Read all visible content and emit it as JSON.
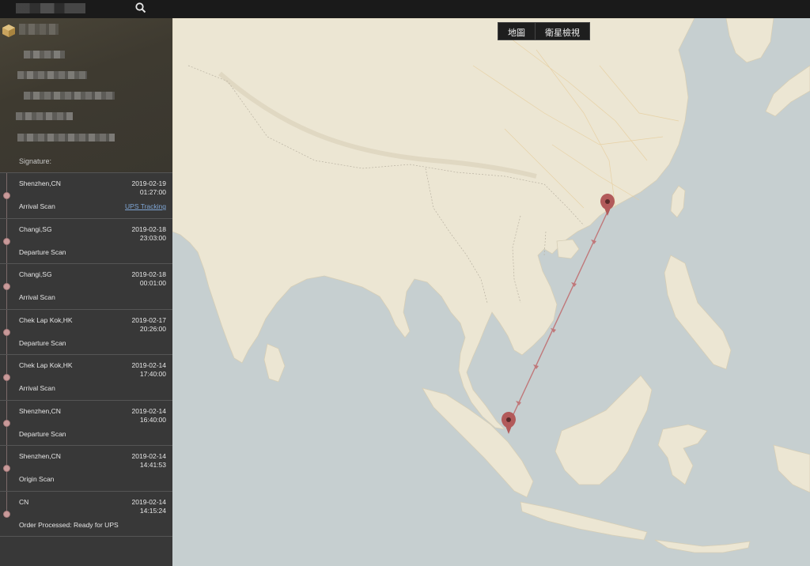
{
  "search": {
    "icon": "search-icon"
  },
  "sidebar": {
    "signature_label": "Signature:",
    "events": [
      {
        "location": "Shenzhen,CN",
        "date": "2019-02-19",
        "time": "01:27:00",
        "status": "Arrival Scan",
        "link": "UPS Tracking"
      },
      {
        "location": "Changi,SG",
        "date": "2019-02-18",
        "time": "23:03:00",
        "status": "Departure Scan"
      },
      {
        "location": "Changi,SG",
        "date": "2019-02-18",
        "time": "00:01:00",
        "status": "Arrival Scan"
      },
      {
        "location": "Chek Lap Kok,HK",
        "date": "2019-02-17",
        "time": "20:26:00",
        "status": "Departure Scan"
      },
      {
        "location": "Chek Lap Kok,HK",
        "date": "2019-02-14",
        "time": "17:40:00",
        "status": "Arrival Scan"
      },
      {
        "location": "Shenzhen,CN",
        "date": "2019-02-14",
        "time": "16:40:00",
        "status": "Departure Scan"
      },
      {
        "location": "Shenzhen,CN",
        "date": "2019-02-14",
        "time": "14:41:53",
        "status": "Origin Scan"
      },
      {
        "location": "CN",
        "date": "2019-02-14",
        "time": "14:15:24",
        "status": "Order Processed: Ready for UPS"
      }
    ]
  },
  "map": {
    "toggle": {
      "map_label": "地圖",
      "satellite_label": "衛星檢視"
    },
    "colors": {
      "water": "#c6cfd0",
      "land": "#ece6d3",
      "route": "#c0787a",
      "marker": "#b25a5a"
    }
  }
}
